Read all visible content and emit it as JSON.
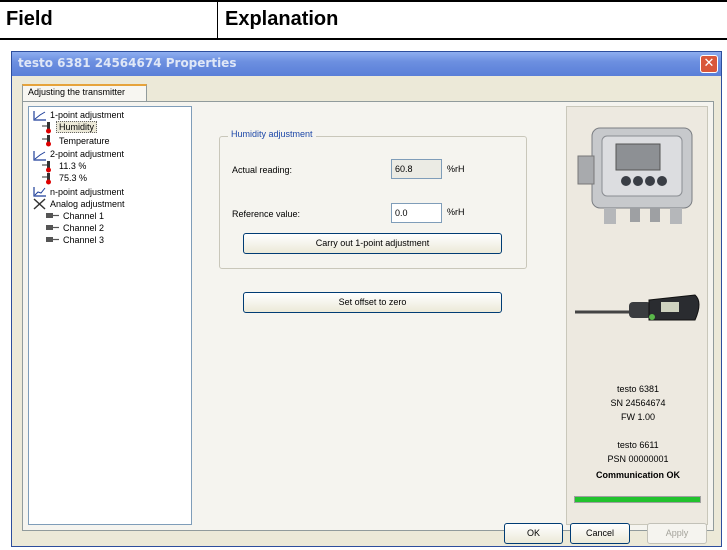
{
  "doc_header": {
    "field": "Field",
    "explanation": "Explanation"
  },
  "window": {
    "title": "testo 6381  24564674 Properties",
    "close_label": "✕",
    "tab_label": "Adjusting the transmitter"
  },
  "tree": {
    "one_point": "1-point adjustment",
    "humidity": "Humidity",
    "temperature": "Temperature",
    "two_point": "2-point adjustment",
    "two_point_low": "11.3 %",
    "two_point_high": "75.3 %",
    "n_point": "n-point adjustment",
    "analog": "Analog adjustment",
    "channel1": "Channel 1",
    "channel2": "Channel 2",
    "channel3": "Channel 3"
  },
  "humidity_group": {
    "title": "Humidity adjustment",
    "actual_label": "Actual reading:",
    "actual_value": "60.8",
    "actual_unit": "%rH",
    "reference_label": "Reference value:",
    "reference_value": "0.0",
    "reference_unit": "%rH",
    "carry_out_button": "Carry out 1-point adjustment"
  },
  "offset_button": "Set offset to zero",
  "device": {
    "model": "testo 6381",
    "serial": "SN 24564674",
    "firmware": "FW 1.00",
    "probe_model": "testo 6611",
    "probe_serial": "PSN 00000001",
    "status": "Communication OK",
    "status_progress": 1.0,
    "status_color": "#22c22e"
  },
  "footer": {
    "ok": "OK",
    "cancel": "Cancel",
    "apply": "Apply"
  }
}
